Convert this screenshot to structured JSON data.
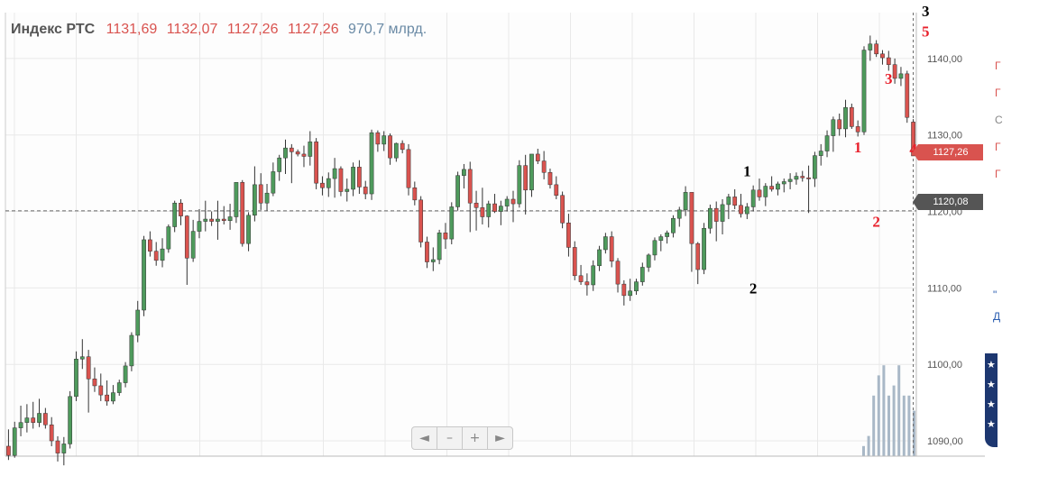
{
  "legend": {
    "name": "Индекс РТС",
    "open": "1131,69",
    "high": "1132,07",
    "low": "1127,26",
    "close": "1127,26",
    "volume": "970,7 млрд."
  },
  "last_price_label": "1127,26",
  "crosshair_price_label": "1120,08",
  "toolbar": {
    "left": "◄",
    "minus": "–",
    "plus": "+",
    "right": "►"
  },
  "colors": {
    "up": "#4e9a5c",
    "down": "#d9534f",
    "grid": "#e9e9e9",
    "volume": "#a9b8c7",
    "axis_text": "#555555",
    "wave_black": "#000000",
    "wave_red": "#e8202b"
  },
  "side_marks": [
    "Г",
    "Г",
    "С",
    "Г",
    "Г"
  ],
  "side_links": [
    "\"",
    "Д"
  ],
  "chart_data": {
    "type": "candlestick",
    "ylim": [
      1088,
      1146
    ],
    "yticks": [
      {
        "value": 1090,
        "label": "1090,00"
      },
      {
        "value": 1100,
        "label": "1100,00"
      },
      {
        "value": 1110,
        "label": "1110,00"
      },
      {
        "value": 1120,
        "label": "1120,00"
      },
      {
        "value": 1130,
        "label": "1130,00"
      },
      {
        "value": 1140,
        "label": "1140,00"
      }
    ],
    "crosshair_value": 1120.08,
    "last_value": 1127.26,
    "candles": [
      [
        1089.3,
        1091.5,
        1087.5,
        1088.1
      ],
      [
        1088.1,
        1092.5,
        1087.8,
        1091.7
      ],
      [
        1091.7,
        1094.6,
        1090.6,
        1092.4
      ],
      [
        1092.4,
        1094.8,
        1091.1,
        1093.0
      ],
      [
        1093.0,
        1095.1,
        1091.6,
        1092.4
      ],
      [
        1092.4,
        1095.5,
        1091.8,
        1093.6
      ],
      [
        1093.6,
        1094.3,
        1091.6,
        1092.1
      ],
      [
        1092.1,
        1093.1,
        1089.3,
        1090.0
      ],
      [
        1090.0,
        1090.6,
        1087.3,
        1088.4
      ],
      [
        1088.4,
        1090.5,
        1086.8,
        1089.6
      ],
      [
        1089.6,
        1096.5,
        1089.0,
        1095.8
      ],
      [
        1095.8,
        1101.7,
        1095.2,
        1100.7
      ],
      [
        1100.7,
        1103.3,
        1099.4,
        1101.0
      ],
      [
        1101.0,
        1101.9,
        1093.7,
        1098.1
      ],
      [
        1098.1,
        1099.6,
        1096.4,
        1097.2
      ],
      [
        1097.2,
        1098.8,
        1095.2,
        1096.0
      ],
      [
        1096.0,
        1097.9,
        1094.6,
        1095.2
      ],
      [
        1095.2,
        1097.3,
        1094.8,
        1096.3
      ],
      [
        1096.3,
        1098.0,
        1095.9,
        1097.6
      ],
      [
        1097.6,
        1100.3,
        1097.0,
        1099.8
      ],
      [
        1099.8,
        1104.2,
        1099.1,
        1103.8
      ],
      [
        1103.8,
        1108.3,
        1102.9,
        1107.1
      ],
      [
        1107.1,
        1116.8,
        1106.3,
        1116.3
      ],
      [
        1116.3,
        1117.4,
        1114.1,
        1114.8
      ],
      [
        1114.8,
        1116.0,
        1112.9,
        1113.6
      ],
      [
        1113.6,
        1116.5,
        1112.7,
        1115.1
      ],
      [
        1115.1,
        1118.3,
        1114.6,
        1118.0
      ],
      [
        1118.0,
        1121.4,
        1117.3,
        1121.1
      ],
      [
        1121.1,
        1121.6,
        1118.2,
        1119.4
      ],
      [
        1119.4,
        1119.5,
        1110.4,
        1113.9
      ],
      [
        1113.9,
        1118.9,
        1113.4,
        1117.4
      ],
      [
        1117.4,
        1120.3,
        1116.5,
        1118.7
      ],
      [
        1118.7,
        1121.4,
        1117.4,
        1119.0
      ],
      [
        1119.0,
        1120.0,
        1118.1,
        1118.7
      ],
      [
        1118.7,
        1121.4,
        1116.3,
        1119.0
      ],
      [
        1119.0,
        1120.7,
        1118.3,
        1118.8
      ],
      [
        1118.8,
        1121.0,
        1117.6,
        1119.3
      ],
      [
        1119.3,
        1122.4,
        1118.5,
        1123.8
      ],
      [
        1123.8,
        1124.1,
        1115.4,
        1115.8
      ],
      [
        1115.8,
        1119.9,
        1114.8,
        1119.5
      ],
      [
        1119.5,
        1125.9,
        1118.7,
        1123.5
      ],
      [
        1123.5,
        1125.0,
        1120.2,
        1121.1
      ],
      [
        1121.1,
        1123.6,
        1120.1,
        1122.4
      ],
      [
        1122.4,
        1126.4,
        1122.0,
        1125.2
      ],
      [
        1125.2,
        1127.4,
        1124.0,
        1127.0
      ],
      [
        1127.0,
        1129.4,
        1124.9,
        1128.3
      ],
      [
        1128.3,
        1128.8,
        1123.7,
        1127.8
      ],
      [
        1127.8,
        1128.1,
        1127.2,
        1127.5
      ],
      [
        1127.5,
        1128.6,
        1125.8,
        1127.2
      ],
      [
        1127.2,
        1130.5,
        1126.0,
        1129.1
      ],
      [
        1129.1,
        1129.6,
        1122.9,
        1123.7
      ],
      [
        1123.7,
        1124.6,
        1122.1,
        1123.1
      ],
      [
        1123.1,
        1125.1,
        1121.9,
        1124.3
      ],
      [
        1124.3,
        1127.0,
        1121.8,
        1125.6
      ],
      [
        1125.6,
        1125.9,
        1122.0,
        1122.6
      ],
      [
        1122.6,
        1124.3,
        1121.3,
        1122.9
      ],
      [
        1122.9,
        1126.4,
        1122.0,
        1125.8
      ],
      [
        1125.8,
        1126.7,
        1122.3,
        1123.2
      ],
      [
        1123.2,
        1124.0,
        1121.6,
        1122.3
      ],
      [
        1122.3,
        1130.7,
        1121.5,
        1130.3
      ],
      [
        1130.3,
        1130.6,
        1127.8,
        1128.8
      ],
      [
        1128.8,
        1130.5,
        1127.9,
        1129.9
      ],
      [
        1129.9,
        1130.2,
        1126.1,
        1127.0
      ],
      [
        1127.0,
        1129.0,
        1126.5,
        1128.9
      ],
      [
        1128.9,
        1129.3,
        1127.6,
        1128.1
      ],
      [
        1128.1,
        1128.8,
        1122.1,
        1123.1
      ],
      [
        1123.1,
        1123.9,
        1120.8,
        1121.5
      ],
      [
        1121.5,
        1122.0,
        1115.3,
        1116.0
      ],
      [
        1116.0,
        1116.7,
        1112.6,
        1113.4
      ],
      [
        1113.4,
        1115.3,
        1112.2,
        1113.7
      ],
      [
        1113.7,
        1117.6,
        1113.1,
        1117.2
      ],
      [
        1117.2,
        1118.5,
        1115.1,
        1116.4
      ],
      [
        1116.4,
        1121.2,
        1115.7,
        1120.6
      ],
      [
        1120.6,
        1125.2,
        1120.1,
        1124.7
      ],
      [
        1124.7,
        1126.2,
        1123.0,
        1125.5
      ],
      [
        1125.5,
        1126.5,
        1117.3,
        1121.1
      ],
      [
        1121.1,
        1122.7,
        1117.5,
        1120.5
      ],
      [
        1120.5,
        1123.1,
        1118.3,
        1119.3
      ],
      [
        1119.3,
        1121.4,
        1117.9,
        1121.0
      ],
      [
        1121.0,
        1122.3,
        1119.8,
        1120.0
      ],
      [
        1120.0,
        1121.4,
        1118.2,
        1120.7
      ],
      [
        1120.7,
        1122.0,
        1120.0,
        1121.6
      ],
      [
        1121.6,
        1122.7,
        1118.6,
        1121.0
      ],
      [
        1121.0,
        1126.7,
        1120.5,
        1126.0
      ],
      [
        1126.0,
        1127.4,
        1119.6,
        1122.8
      ],
      [
        1122.8,
        1127.2,
        1121.9,
        1127.5
      ],
      [
        1127.5,
        1128.2,
        1126.2,
        1126.6
      ],
      [
        1126.6,
        1127.9,
        1124.2,
        1125.1
      ],
      [
        1125.1,
        1125.6,
        1123.0,
        1123.5
      ],
      [
        1123.5,
        1124.6,
        1121.6,
        1122.1
      ],
      [
        1122.1,
        1122.6,
        1117.8,
        1118.5
      ],
      [
        1118.5,
        1119.7,
        1114.1,
        1115.3
      ],
      [
        1115.3,
        1116.1,
        1111.0,
        1111.6
      ],
      [
        1111.6,
        1113.0,
        1110.4,
        1110.8
      ],
      [
        1110.8,
        1111.9,
        1109.0,
        1110.4
      ],
      [
        1110.4,
        1113.6,
        1109.6,
        1112.9
      ],
      [
        1112.9,
        1115.5,
        1112.2,
        1115.0
      ],
      [
        1115.0,
        1117.2,
        1114.5,
        1116.7
      ],
      [
        1116.7,
        1117.4,
        1112.7,
        1113.5
      ],
      [
        1113.5,
        1113.9,
        1109.4,
        1110.5
      ],
      [
        1110.5,
        1111.0,
        1107.7,
        1109.0
      ],
      [
        1109.0,
        1111.2,
        1108.3,
        1109.6
      ],
      [
        1109.6,
        1111.2,
        1109.1,
        1110.8
      ],
      [
        1110.8,
        1113.3,
        1110.3,
        1112.7
      ],
      [
        1112.7,
        1114.5,
        1112.1,
        1114.3
      ],
      [
        1114.3,
        1116.6,
        1113.6,
        1116.2
      ],
      [
        1116.2,
        1117.0,
        1114.8,
        1116.7
      ],
      [
        1116.7,
        1117.5,
        1115.8,
        1117.2
      ],
      [
        1117.2,
        1119.5,
        1116.6,
        1119.1
      ],
      [
        1119.1,
        1120.6,
        1118.0,
        1120.2
      ],
      [
        1120.2,
        1123.3,
        1119.4,
        1122.5
      ],
      [
        1122.5,
        1116.4,
        1112.1,
        1115.8
      ],
      [
        1115.8,
        1116.0,
        1110.5,
        1112.4
      ],
      [
        1112.4,
        1118.5,
        1111.8,
        1117.8
      ],
      [
        1117.8,
        1120.9,
        1117.1,
        1120.4
      ],
      [
        1120.4,
        1121.3,
        1116.1,
        1118.7
      ],
      [
        1118.7,
        1121.6,
        1117.0,
        1120.9
      ],
      [
        1120.9,
        1122.3,
        1119.0,
        1121.9
      ],
      [
        1121.9,
        1122.9,
        1120.3,
        1120.8
      ],
      [
        1120.8,
        1122.3,
        1119.2,
        1119.7
      ],
      [
        1119.7,
        1121.1,
        1119.0,
        1120.6
      ],
      [
        1120.6,
        1123.4,
        1120.0,
        1122.8
      ],
      [
        1122.8,
        1124.3,
        1121.4,
        1121.9
      ],
      [
        1121.9,
        1123.7,
        1120.7,
        1123.3
      ],
      [
        1123.3,
        1124.6,
        1122.6,
        1122.9
      ],
      [
        1122.9,
        1123.9,
        1122.1,
        1123.6
      ],
      [
        1123.6,
        1124.3,
        1122.5,
        1123.9
      ],
      [
        1123.9,
        1125.0,
        1122.9,
        1124.2
      ],
      [
        1124.2,
        1125.1,
        1123.5,
        1124.6
      ],
      [
        1124.6,
        1125.3,
        1123.9,
        1124.4
      ],
      [
        1124.4,
        1126.0,
        1119.8,
        1124.3
      ],
      [
        1124.3,
        1127.8,
        1123.2,
        1127.3
      ],
      [
        1127.3,
        1128.8,
        1126.0,
        1127.9
      ],
      [
        1127.9,
        1130.6,
        1127.1,
        1129.9
      ],
      [
        1129.9,
        1132.4,
        1127.8,
        1132.0
      ],
      [
        1132.0,
        1132.8,
        1129.9,
        1130.8
      ],
      [
        1130.8,
        1134.6,
        1129.7,
        1133.6
      ],
      [
        1133.6,
        1134.1,
        1130.8,
        1131.1
      ],
      [
        1131.1,
        1131.9,
        1129.8,
        1130.4
      ],
      [
        1130.4,
        1141.6,
        1130.0,
        1141.1
      ],
      [
        1141.1,
        1143.0,
        1139.7,
        1141.9
      ],
      [
        1141.9,
        1142.4,
        1140.2,
        1140.6
      ],
      [
        1140.6,
        1141.1,
        1139.2,
        1140.1
      ],
      [
        1140.1,
        1141.0,
        1138.4,
        1139.2
      ],
      [
        1139.2,
        1140.0,
        1136.7,
        1137.4
      ],
      [
        1137.4,
        1138.9,
        1136.4,
        1138.0
      ],
      [
        1138.0,
        1138.4,
        1131.6,
        1132.3
      ],
      [
        1131.69,
        1132.07,
        1127.26,
        1127.26
      ]
    ],
    "volume_bars": [
      0.1,
      0.2,
      0.6,
      0.8,
      0.9,
      0.6,
      0.7,
      0.9,
      0.6,
      0.6,
      0.45
    ],
    "wave_labels": [
      {
        "text": "1",
        "x_index": 120,
        "value": 1124.6,
        "color": "black"
      },
      {
        "text": "2",
        "x_index": 121,
        "value": 1109.3,
        "color": "black"
      },
      {
        "text": "3",
        "x_index": 149,
        "value": 1145.5,
        "color": "black"
      },
      {
        "text": "1",
        "x_index": 138,
        "value": 1127.7,
        "color": "red"
      },
      {
        "text": "2",
        "x_index": 141,
        "value": 1118.0,
        "color": "red"
      },
      {
        "text": "3",
        "x_index": 143,
        "value": 1136.7,
        "color": "red"
      },
      {
        "text": "4",
        "x_index": 147,
        "value": 1127.5,
        "color": "red"
      },
      {
        "text": "5",
        "x_index": 149,
        "value": 1142.9,
        "color": "red"
      }
    ]
  }
}
